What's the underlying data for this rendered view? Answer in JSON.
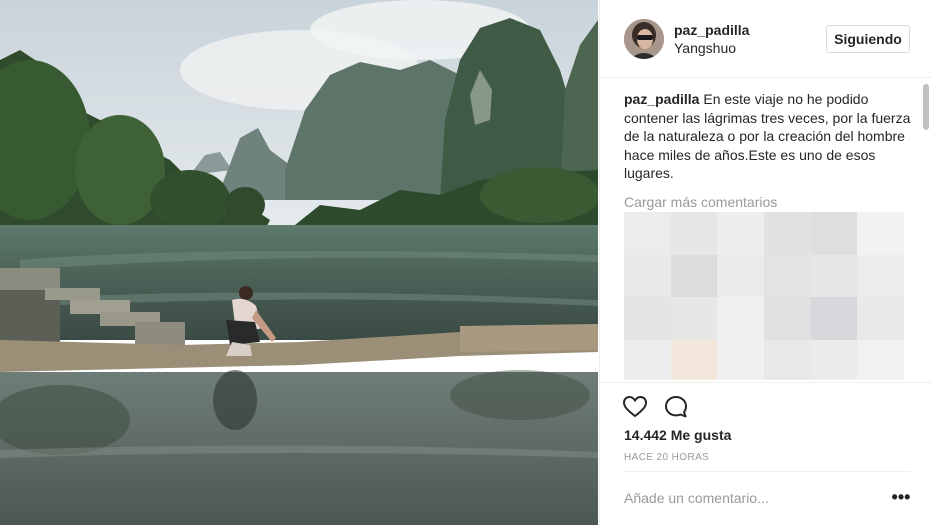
{
  "post": {
    "username": "paz_padilla",
    "location": "Yangshuo",
    "follow_label": "Siguiendo",
    "caption_user": "paz_padilla",
    "caption_text": " En este viaje no he podido contener las lágrimas tres veces, por la fuerza de la naturaleza o por la creación del hombre hace miles de años.Este es uno de esos lugares.",
    "load_more_comments": "Cargar más comentarios",
    "likes": "14.442 Me gusta",
    "timestamp": "HACE 20 HORAS",
    "comment_placeholder": "Añade un comentario...",
    "more_options_label": "•••"
  },
  "icons": {
    "like": "heart-icon",
    "comment": "comment-bubble-icon",
    "more": "more-options-icon"
  },
  "colors": {
    "text": "#262626",
    "secondary_text": "#999999",
    "border": "#efefef",
    "button_border": "#dbdbdb"
  }
}
